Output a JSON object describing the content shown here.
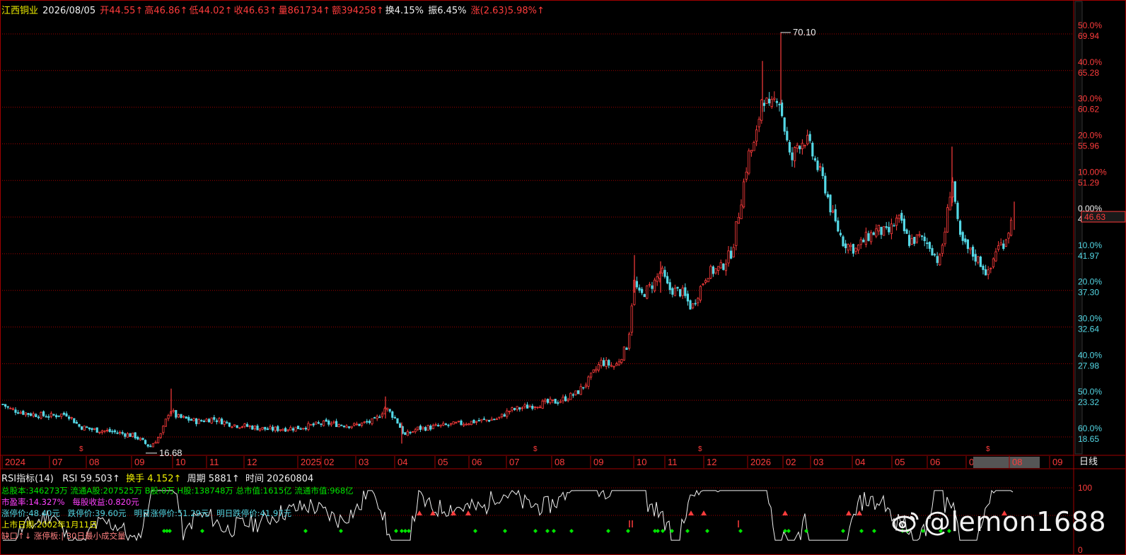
{
  "header": {
    "stock_name": "江西铜业",
    "date": "2026/08/05",
    "open": "开44.55↑",
    "high": "高46.86↑",
    "low": "低44.02↑",
    "close": "收46.63↑",
    "volume": "量861734↑",
    "amount": "额394258↑",
    "turnover": "换4.15%",
    "amplitude": "振6.45%",
    "change": "涨(2.63)5.98%↑"
  },
  "price_axis": {
    "labels": [
      {
        "pct": "50.0%",
        "price": "69.94"
      },
      {
        "pct": "40.0%",
        "price": "65.28"
      },
      {
        "pct": "30.0%",
        "price": "60.62"
      },
      {
        "pct": "20.0%",
        "price": "55.96"
      },
      {
        "pct": "10.00%",
        "price": "51.29"
      },
      {
        "pct": "0.00%",
        "price": "46.63"
      },
      {
        "pct": "10.0%",
        "price": "41.97"
      },
      {
        "pct": "20.0%",
        "price": "37.30"
      },
      {
        "pct": "30.0%",
        "price": "32.64"
      },
      {
        "pct": "40.0%",
        "price": "27.98"
      },
      {
        "pct": "50.0%",
        "price": "23.32"
      },
      {
        "pct": "60.0%",
        "price": "18.65"
      }
    ],
    "current_price_label": "46.63",
    "high_annotation": "70.10",
    "low_annotation": "16.68"
  },
  "time_axis": {
    "labels": [
      "2024",
      "07",
      "08",
      "09",
      "10",
      "11",
      "12",
      "2025",
      "02",
      "03",
      "04",
      "05",
      "06",
      "07",
      "08",
      "09",
      "10",
      "11",
      "12",
      "2026",
      "02",
      "03",
      "04",
      "05",
      "06",
      "07",
      "08",
      "09"
    ],
    "period_label": "日线"
  },
  "indicator": {
    "name": "RSI指标(14)",
    "rsi": "RSI 59.503↑",
    "turnover": "换手 4.152↑",
    "period": "周期 5881↑",
    "time": "时间 20260804",
    "axis_labels": [
      "100",
      "0"
    ]
  },
  "info_lines": {
    "line1": "总股本:346273万  流通A股:207525万  B股:0万  H股:138748万  总市值:1615亿  流通市值:968亿",
    "line2a": "市盈率:14.327%",
    "line2b": "每股收益:0.820元",
    "line3a": "涨停价:48.40元",
    "line3b": "跌停价:39.60元",
    "line3c": "明日涨停价:51.29元",
    "line3d": "明日跌停价:41.97元",
    "line4": "上市日期:2002年1月11日",
    "line5": "缺口↑↓  涨停板:|  30日最小成交量"
  },
  "watermark": "@lemon1688",
  "colors": {
    "up": "#ff3c3c",
    "down": "#54d8e6",
    "grid": "#a00000",
    "yellow": "#f0f000",
    "green": "#00e600",
    "magenta": "#ff40ff",
    "white": "#f0f0f0"
  },
  "chart_data": {
    "type": "candlestick",
    "x": [
      "2024",
      "07",
      "08",
      "09",
      "10",
      "11",
      "12",
      "2025",
      "02",
      "03",
      "04",
      "05",
      "06",
      "07",
      "08",
      "09",
      "10",
      "11",
      "12",
      "2026",
      "02",
      "03",
      "04",
      "05",
      "06",
      "07",
      "08",
      "09"
    ],
    "close_approx": [
      22.5,
      21.5,
      19.5,
      17.5,
      22.0,
      21.0,
      20.0,
      19.5,
      20.0,
      21.0,
      19.5,
      20.5,
      21.0,
      22.0,
      23.0,
      26.5,
      38.0,
      37.5,
      42.0,
      60.0,
      56.0,
      50.0,
      43.0,
      45.0,
      43.0,
      41.0,
      46.63
    ],
    "ylim": [
      18.65,
      69.94
    ],
    "high": 70.1,
    "low": 16.68,
    "last_close": 46.63,
    "grid": true
  }
}
